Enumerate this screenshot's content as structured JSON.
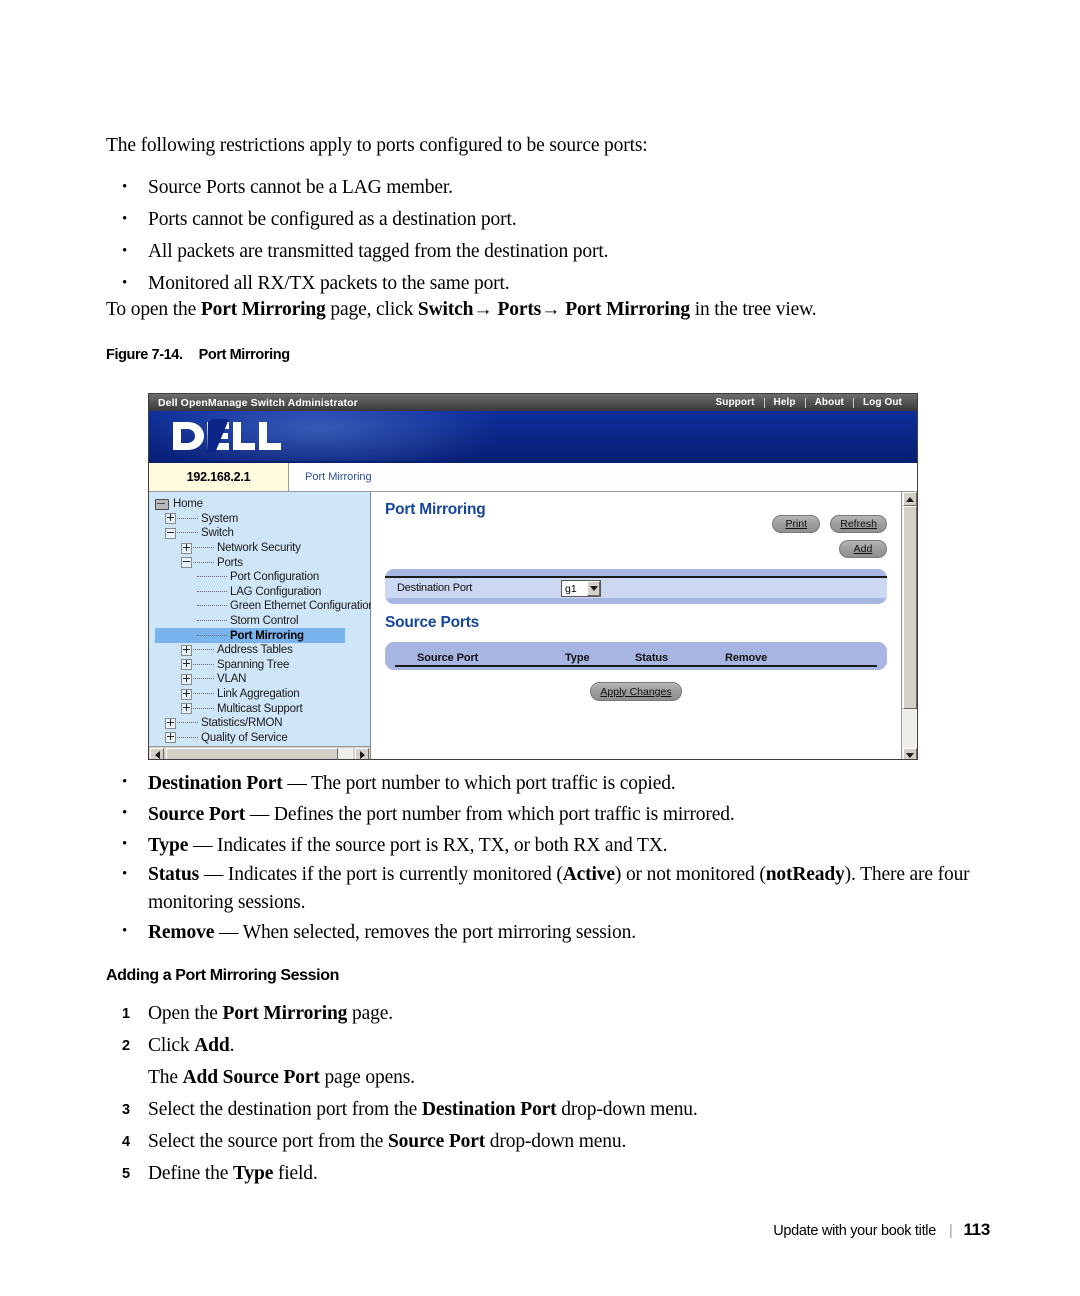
{
  "document": {
    "intro_paragraph": "The following restrictions apply to ports configured to be source ports:",
    "restrictions": [
      "Source Ports cannot be a LAG member.",
      "Ports cannot be configured as a destination port.",
      "All packets are transmitted tagged from the destination port.",
      "Monitored all RX/TX packets to the same port."
    ],
    "tree_instruction": {
      "prefix": "To open the ",
      "bold1": "Port Mirroring",
      "mid1": " page, click ",
      "bold2": "Switch",
      "arrow1": "→",
      "bold3": " Ports",
      "arrow2": "→",
      "bold4": " Port Mirroring",
      "suffix": " in the tree view."
    },
    "figure_caption": {
      "number": "Figure 7-14.",
      "title": "Port Mirroring"
    },
    "field_descriptions": [
      {
        "term": "Destination Port",
        "desc": " — The port number to which port traffic is copied."
      },
      {
        "term": "Source Port",
        "desc": " — Defines the port number from which port traffic is mirrored."
      },
      {
        "term": "Type",
        "desc": " — Indicates if the source port is RX, TX, or both RX and TX."
      },
      {
        "term": "Status",
        "desc_a": " — Indicates if the port is currently monitored (",
        "bold_a": "Active",
        "desc_b": ") or not monitored (",
        "bold_b": "notReady",
        "desc_c": "). There are four monitoring sessions."
      },
      {
        "term": "Remove",
        "desc": " — When selected, removes the port mirroring session."
      }
    ],
    "section_heading": "Adding a Port Mirroring Session",
    "steps": [
      {
        "num": "1",
        "pre": "Open the ",
        "bold": "Port Mirroring",
        "post": " page."
      },
      {
        "num": "2",
        "pre": "Click ",
        "bold": "Add",
        "post": "."
      },
      {
        "num": "",
        "pre": "The ",
        "bold": "Add Source Port",
        "post": " page opens."
      },
      {
        "num": "3",
        "pre": "Select the destination port from the ",
        "bold": "Destination Port",
        "post": " drop-down menu."
      },
      {
        "num": "4",
        "pre": "Select the source port from the ",
        "bold": "Source Port",
        "post": " drop-down menu."
      },
      {
        "num": "5",
        "pre": "Define the ",
        "bold": "Type",
        "post": " field."
      }
    ],
    "footer": {
      "book_title": "Update with your book title",
      "separator": "|",
      "page_number": "113"
    }
  },
  "screenshot": {
    "titlebar": {
      "app_title": "Dell OpenManage Switch Administrator",
      "nav": [
        "Support",
        "Help",
        "About",
        "Log Out"
      ]
    },
    "brand": {
      "logo_text": "DELL"
    },
    "tabstrip": {
      "ip_address": "192.168.2.1",
      "breadcrumb": "Port Mirroring"
    },
    "tree": {
      "nodes": [
        {
          "label": "Home",
          "level": 0,
          "icon": "home-icon",
          "selected": false
        },
        {
          "label": "System",
          "level": 1,
          "icon": "plus-box",
          "selected": false
        },
        {
          "label": "Switch",
          "level": 1,
          "icon": "minus-box",
          "selected": false
        },
        {
          "label": "Network Security",
          "level": 2,
          "icon": "plus-box",
          "selected": false
        },
        {
          "label": "Ports",
          "level": 2,
          "icon": "minus-box",
          "selected": false
        },
        {
          "label": "Port Configuration",
          "level": 3,
          "icon": "leaf",
          "selected": false
        },
        {
          "label": "LAG Configuration",
          "level": 3,
          "icon": "leaf",
          "selected": false
        },
        {
          "label": "Green Ethernet Configuration",
          "level": 3,
          "icon": "leaf",
          "selected": false
        },
        {
          "label": "Storm Control",
          "level": 3,
          "icon": "leaf",
          "selected": false
        },
        {
          "label": "Port Mirroring",
          "level": 3,
          "icon": "leaf",
          "selected": true
        },
        {
          "label": "Address Tables",
          "level": 2,
          "icon": "plus-box",
          "selected": false
        },
        {
          "label": "Spanning Tree",
          "level": 2,
          "icon": "plus-box",
          "selected": false
        },
        {
          "label": "VLAN",
          "level": 2,
          "icon": "plus-box",
          "selected": false
        },
        {
          "label": "Link Aggregation",
          "level": 2,
          "icon": "plus-box",
          "selected": false
        },
        {
          "label": "Multicast Support",
          "level": 2,
          "icon": "plus-box",
          "selected": false
        },
        {
          "label": "Statistics/RMON",
          "level": 1,
          "icon": "plus-box",
          "selected": false
        },
        {
          "label": "Quality of Service",
          "level": 1,
          "icon": "plus-box",
          "selected": false
        }
      ]
    },
    "content": {
      "heading": "Port Mirroring",
      "buttons": {
        "print": "Print",
        "refresh": "Refresh",
        "add": "Add",
        "apply": "Apply Changes"
      },
      "destination": {
        "label": "Destination Port",
        "selected_value": "g1"
      },
      "source_ports": {
        "heading": "Source Ports",
        "columns": [
          "Source Port",
          "Type",
          "Status",
          "Remove"
        ],
        "rows": []
      }
    },
    "colors": {
      "brand_blue": "#0b2a8c",
      "heading_blue": "#15469b",
      "tree_bg": "#cfe6f8",
      "tree_selected": "#79b4ee",
      "band_outer": "#a7b5e2",
      "band_inner": "#ccd7f2",
      "ip_tab_bg": "#fdfade"
    }
  }
}
